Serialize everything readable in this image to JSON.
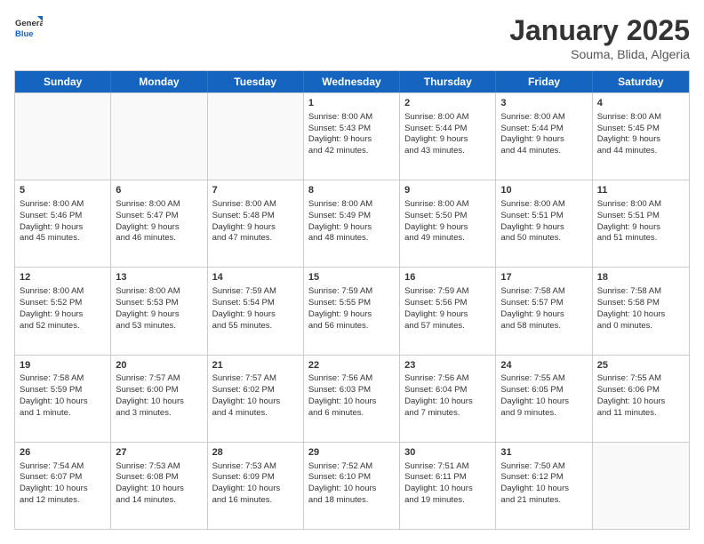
{
  "header": {
    "logo_general": "General",
    "logo_blue": "Blue",
    "title": "January 2025",
    "subtitle": "Souma, Blida, Algeria"
  },
  "days": [
    "Sunday",
    "Monday",
    "Tuesday",
    "Wednesday",
    "Thursday",
    "Friday",
    "Saturday"
  ],
  "weeks": [
    [
      {
        "day": "",
        "content": ""
      },
      {
        "day": "",
        "content": ""
      },
      {
        "day": "",
        "content": ""
      },
      {
        "day": "1",
        "content": "Sunrise: 8:00 AM\nSunset: 5:43 PM\nDaylight: 9 hours\nand 42 minutes."
      },
      {
        "day": "2",
        "content": "Sunrise: 8:00 AM\nSunset: 5:44 PM\nDaylight: 9 hours\nand 43 minutes."
      },
      {
        "day": "3",
        "content": "Sunrise: 8:00 AM\nSunset: 5:44 PM\nDaylight: 9 hours\nand 44 minutes."
      },
      {
        "day": "4",
        "content": "Sunrise: 8:00 AM\nSunset: 5:45 PM\nDaylight: 9 hours\nand 44 minutes."
      }
    ],
    [
      {
        "day": "5",
        "content": "Sunrise: 8:00 AM\nSunset: 5:46 PM\nDaylight: 9 hours\nand 45 minutes."
      },
      {
        "day": "6",
        "content": "Sunrise: 8:00 AM\nSunset: 5:47 PM\nDaylight: 9 hours\nand 46 minutes."
      },
      {
        "day": "7",
        "content": "Sunrise: 8:00 AM\nSunset: 5:48 PM\nDaylight: 9 hours\nand 47 minutes."
      },
      {
        "day": "8",
        "content": "Sunrise: 8:00 AM\nSunset: 5:49 PM\nDaylight: 9 hours\nand 48 minutes."
      },
      {
        "day": "9",
        "content": "Sunrise: 8:00 AM\nSunset: 5:50 PM\nDaylight: 9 hours\nand 49 minutes."
      },
      {
        "day": "10",
        "content": "Sunrise: 8:00 AM\nSunset: 5:51 PM\nDaylight: 9 hours\nand 50 minutes."
      },
      {
        "day": "11",
        "content": "Sunrise: 8:00 AM\nSunset: 5:51 PM\nDaylight: 9 hours\nand 51 minutes."
      }
    ],
    [
      {
        "day": "12",
        "content": "Sunrise: 8:00 AM\nSunset: 5:52 PM\nDaylight: 9 hours\nand 52 minutes."
      },
      {
        "day": "13",
        "content": "Sunrise: 8:00 AM\nSunset: 5:53 PM\nDaylight: 9 hours\nand 53 minutes."
      },
      {
        "day": "14",
        "content": "Sunrise: 7:59 AM\nSunset: 5:54 PM\nDaylight: 9 hours\nand 55 minutes."
      },
      {
        "day": "15",
        "content": "Sunrise: 7:59 AM\nSunset: 5:55 PM\nDaylight: 9 hours\nand 56 minutes."
      },
      {
        "day": "16",
        "content": "Sunrise: 7:59 AM\nSunset: 5:56 PM\nDaylight: 9 hours\nand 57 minutes."
      },
      {
        "day": "17",
        "content": "Sunrise: 7:58 AM\nSunset: 5:57 PM\nDaylight: 9 hours\nand 58 minutes."
      },
      {
        "day": "18",
        "content": "Sunrise: 7:58 AM\nSunset: 5:58 PM\nDaylight: 10 hours\nand 0 minutes."
      }
    ],
    [
      {
        "day": "19",
        "content": "Sunrise: 7:58 AM\nSunset: 5:59 PM\nDaylight: 10 hours\nand 1 minute."
      },
      {
        "day": "20",
        "content": "Sunrise: 7:57 AM\nSunset: 6:00 PM\nDaylight: 10 hours\nand 3 minutes."
      },
      {
        "day": "21",
        "content": "Sunrise: 7:57 AM\nSunset: 6:02 PM\nDaylight: 10 hours\nand 4 minutes."
      },
      {
        "day": "22",
        "content": "Sunrise: 7:56 AM\nSunset: 6:03 PM\nDaylight: 10 hours\nand 6 minutes."
      },
      {
        "day": "23",
        "content": "Sunrise: 7:56 AM\nSunset: 6:04 PM\nDaylight: 10 hours\nand 7 minutes."
      },
      {
        "day": "24",
        "content": "Sunrise: 7:55 AM\nSunset: 6:05 PM\nDaylight: 10 hours\nand 9 minutes."
      },
      {
        "day": "25",
        "content": "Sunrise: 7:55 AM\nSunset: 6:06 PM\nDaylight: 10 hours\nand 11 minutes."
      }
    ],
    [
      {
        "day": "26",
        "content": "Sunrise: 7:54 AM\nSunset: 6:07 PM\nDaylight: 10 hours\nand 12 minutes."
      },
      {
        "day": "27",
        "content": "Sunrise: 7:53 AM\nSunset: 6:08 PM\nDaylight: 10 hours\nand 14 minutes."
      },
      {
        "day": "28",
        "content": "Sunrise: 7:53 AM\nSunset: 6:09 PM\nDaylight: 10 hours\nand 16 minutes."
      },
      {
        "day": "29",
        "content": "Sunrise: 7:52 AM\nSunset: 6:10 PM\nDaylight: 10 hours\nand 18 minutes."
      },
      {
        "day": "30",
        "content": "Sunrise: 7:51 AM\nSunset: 6:11 PM\nDaylight: 10 hours\nand 19 minutes."
      },
      {
        "day": "31",
        "content": "Sunrise: 7:50 AM\nSunset: 6:12 PM\nDaylight: 10 hours\nand 21 minutes."
      },
      {
        "day": "",
        "content": ""
      }
    ]
  ]
}
